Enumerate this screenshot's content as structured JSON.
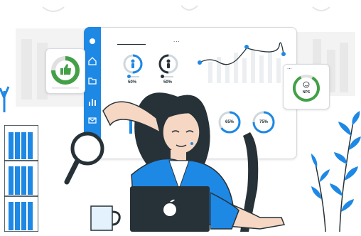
{
  "colors": {
    "primary": "#1e88e5",
    "dark": "#263238",
    "green": "#43a047",
    "skin": "#f6d7c3",
    "background_gray": "#eeeeee"
  },
  "dashboard": {
    "sidebar_icons": [
      "circle-icon",
      "home-icon",
      "folder-icon",
      "bar-chart-icon",
      "mail-icon"
    ],
    "menu_dots": "...",
    "stat_left": {
      "value": "50%",
      "icon": "person-icon"
    },
    "stat_right": {
      "value": "50%",
      "icon": "person-icon"
    },
    "bottom_ring_left": {
      "value": "65%",
      "fraction": 0.65
    },
    "bottom_ring_right": {
      "value": "75%",
      "fraction": 0.75
    }
  },
  "thumbs_card": {
    "icon": "thumbs-up-icon"
  },
  "nps_card": {
    "label": "NPS",
    "icon": "smiley-icon",
    "menu_dots": "..."
  },
  "decor": [
    "bookshelf",
    "magnifier-icon",
    "coffee-mug",
    "plant-leaves",
    "laptop",
    "apple-logo-icon",
    "office-chair"
  ]
}
